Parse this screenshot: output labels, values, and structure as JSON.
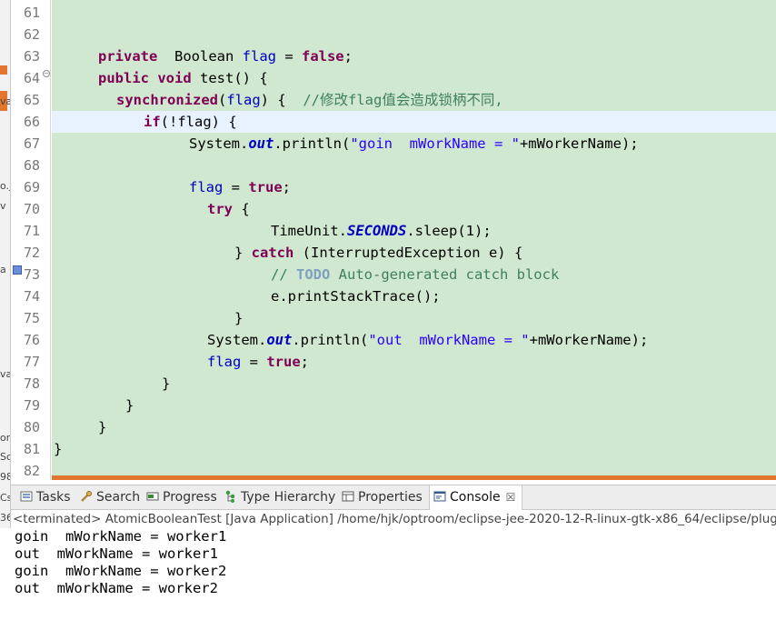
{
  "left_strip": {
    "fragments": [
      "va",
      "o.j",
      "v",
      "a",
      "va",
      "or",
      "Sc",
      "98",
      "Cs",
      "36"
    ]
  },
  "editor": {
    "line_numbers": [
      "61",
      "62",
      "63",
      "64",
      "65",
      "66",
      "67",
      "68",
      "69",
      "70",
      "71",
      "72",
      "73",
      "74",
      "75",
      "76",
      "77",
      "78",
      "79",
      "80",
      "81",
      "82"
    ],
    "current_line": "66",
    "code": {
      "l61": "",
      "l62": "",
      "l63": {
        "kw1": "private",
        "type": "  Boolean ",
        "fld": "flag",
        "eq": " = ",
        "kw2": "false",
        "semi": ";"
      },
      "l64": {
        "kw1": "public",
        "sp": " ",
        "kw2": "void",
        "rest": " test() {"
      },
      "l65": {
        "kw": "synchronized",
        "p1": "(",
        "fld": "flag",
        "p2": ") {  ",
        "cmt": "//修改flag值会造成锁柄不同,"
      },
      "l66": {
        "kw": "if",
        "rest": "(!flag) {"
      },
      "l67": {
        "a": "System.",
        "sfld": "out",
        "b": ".println(",
        "str": "\"goin  mWorkName = \"",
        "c": "+mWorkerName);"
      },
      "l68": "",
      "l69": {
        "fld": "flag",
        "eq": " = ",
        "kw": "true",
        "semi": ";"
      },
      "l70": {
        "kw": "try",
        "rest": " {"
      },
      "l71": {
        "a": "TimeUnit.",
        "sfld": "SECONDS",
        "b": ".sleep(1);"
      },
      "l72": {
        "a": "} ",
        "kw": "catch",
        "b": " (InterruptedException e) {"
      },
      "l73": {
        "c1": "// ",
        "todo": "TODO",
        "c2": " Auto-generated catch block"
      },
      "l74": "e.printStackTrace();",
      "l75": "}",
      "l76": {
        "a": "System.",
        "sfld": "out",
        "b": ".println(",
        "str": "\"out  mWorkName = \"",
        "c": "+mWorkerName);"
      },
      "l77": {
        "fld": "flag",
        "eq": " = ",
        "kw": "true",
        "semi": ";"
      },
      "l78": "}",
      "l79": "}",
      "l80": "}",
      "l81": "}",
      "l82": ""
    }
  },
  "views": {
    "tabs": [
      {
        "label": "Tasks",
        "icon": "tasks-icon"
      },
      {
        "label": "Search",
        "icon": "search-icon"
      },
      {
        "label": "Progress",
        "icon": "progress-icon"
      },
      {
        "label": "Type Hierarchy",
        "icon": "type-hierarchy-icon"
      },
      {
        "label": "Properties",
        "icon": "properties-icon"
      },
      {
        "label": "Console",
        "icon": "console-icon",
        "active": true
      }
    ],
    "close_glyph": "☒"
  },
  "console": {
    "header": "<terminated> AtomicBooleanTest [Java Application] /home/hjk/optroom/eclipse-jee-2020-12-R-linux-gtk-x86_64/eclipse/plugi",
    "output": [
      "goin  mWorkName = worker1",
      "out  mWorkName = worker1",
      "goin  mWorkName = worker2",
      "out  mWorkName = worker2"
    ]
  },
  "colors": {
    "editor_bg": "#cfe8cf",
    "current_line": "#e8f2fe",
    "keyword": "#7f0055",
    "field": "#0000c0",
    "string": "#2a00ff",
    "comment": "#3f7f5f",
    "accent_orange": "#e2762f"
  }
}
